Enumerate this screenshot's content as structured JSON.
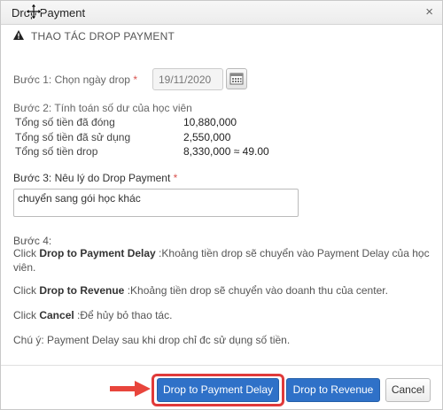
{
  "dialog": {
    "title": "Drop Payment",
    "close_glyph": "×"
  },
  "section": {
    "title": "THAO TÁC DROP PAYMENT",
    "icon": "warning-icon"
  },
  "step1": {
    "label": "Bước 1: Chọn ngày drop",
    "required_mark": "*",
    "date_value": "19/11/2020"
  },
  "step2": {
    "label": "Bước 2: Tính toán số dư của học viên",
    "rows": [
      {
        "label": "Tổng số tiền đã đóng",
        "value": "10,880,000"
      },
      {
        "label": "Tổng số tiền đã sử dụng",
        "value": "2,550,000"
      },
      {
        "label": "Tổng số tiền drop",
        "value": "8,330,000 ≈ 49.00"
      }
    ]
  },
  "step3": {
    "label": "Bước 3: Nêu lý do Drop Payment",
    "required_mark": "*",
    "reason_value": "chuyển sang gói học khác"
  },
  "step4": {
    "label": "Bước 4:",
    "line1_prefix": "Click ",
    "line1_bold": "Drop to Payment Delay",
    "line1_text": " :Khoảng tiền drop sẽ chuyển vào Payment Delay của học viên.",
    "line2_prefix": "Click ",
    "line2_bold": "Drop to Revenue",
    "line2_text": " :Khoảng tiền drop sẽ chuyển vào doanh thu của center.",
    "line3_prefix": "Click ",
    "line3_bold": "Cancel",
    "line3_text": " :Để hủy bỏ thao tác.",
    "note": "Chú ý: Payment Delay sau khi drop chỉ đc sử dụng số tiền."
  },
  "buttons": {
    "drop_to_payment_delay": "Drop to Payment Delay",
    "drop_to_revenue": "Drop to Revenue",
    "cancel": "Cancel"
  },
  "colors": {
    "primary": "#2f71c8",
    "highlight": "#e03a3a",
    "required": "#d9534f"
  }
}
